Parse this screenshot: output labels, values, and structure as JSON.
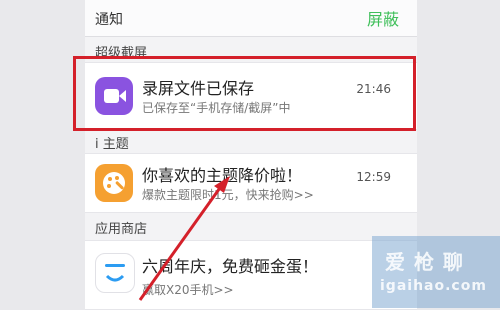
{
  "header": {
    "title": "通知",
    "action": "屏蔽"
  },
  "sections": [
    {
      "label": "超级截屏",
      "card": {
        "title": "录屏文件已保存",
        "subtitle": "已保存至“手机存储/截屏”中",
        "time": "21:46",
        "icon": "video-camera-icon",
        "icon_color": "#8a53e0"
      }
    },
    {
      "label": "i 主题",
      "card": {
        "title": "你喜欢的主题降价啦！",
        "subtitle": "爆款主题限时1元，快来抢购>>",
        "time": "12:59",
        "icon": "palette-icon",
        "icon_color": "#f5a031"
      }
    },
    {
      "label": "应用商店",
      "card": {
        "title": "六周年庆，免费砸金蛋！",
        "subtitle": "赢取X20手机>>",
        "time": "",
        "icon": "app-store-icon",
        "icon_color": "#ffffff"
      }
    }
  ],
  "annotation": {
    "highlight_color": "#d4202a",
    "arrow_color": "#d4202a"
  },
  "watermark": {
    "line1": "爱 枪 聊",
    "line2": "igaihao.com"
  }
}
